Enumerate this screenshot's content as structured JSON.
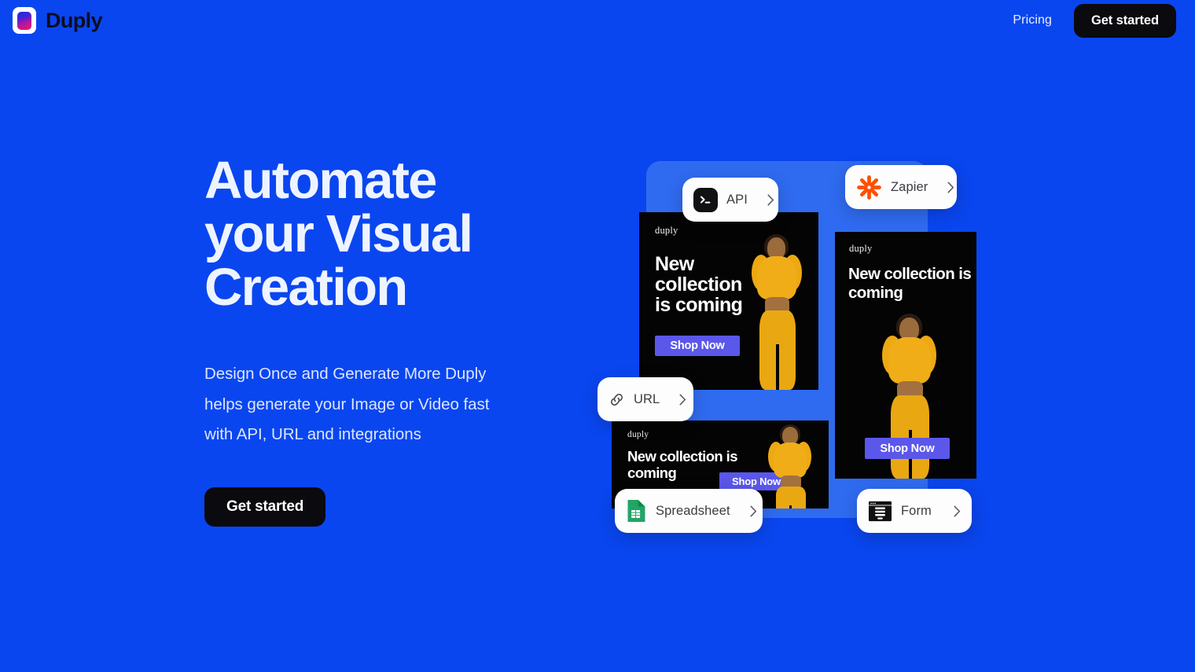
{
  "header": {
    "brand_name": "Duply",
    "brand_icon": "duply-logo-icon",
    "nav_links": [
      {
        "label": "Pricing",
        "name": "nav-link-pricing"
      }
    ],
    "cta_label": "Get started"
  },
  "hero": {
    "title_lines": [
      "Automate",
      "your Visual",
      "Creation"
    ],
    "title_full": "Automate your Visual Creation",
    "subtitle": "Design Once and Generate More Duply helps generate your Image or Video fast with API, URL and integrations",
    "cta_label": "Get started"
  },
  "integrations": [
    {
      "id": "api",
      "label": "API",
      "icon": "terminal-icon",
      "chevron": "chevron-right-icon"
    },
    {
      "id": "zapier",
      "label": "Zapier",
      "icon": "zapier-icon",
      "chevron": "chevron-right-icon"
    },
    {
      "id": "url",
      "label": "URL",
      "icon": "link-icon",
      "chevron": "chevron-right-icon"
    },
    {
      "id": "spreadsheet",
      "label": "Spreadsheet",
      "icon": "spreadsheet-icon",
      "chevron": "chevron-right-icon"
    },
    {
      "id": "form",
      "label": "Form",
      "icon": "form-icon",
      "chevron": "chevron-right-icon"
    }
  ],
  "creatives": [
    {
      "id": "creative-1",
      "brand": "duply",
      "headline": "New collection is coming",
      "button_label": "Shop Now",
      "format": "landscape"
    },
    {
      "id": "creative-2",
      "brand": "duply",
      "headline": "New collection is coming",
      "button_label": "Shop Now",
      "format": "portrait"
    },
    {
      "id": "creative-3",
      "brand": "duply",
      "headline": "New collection is coming",
      "button_label": "Shop Now",
      "format": "banner"
    }
  ],
  "colors": {
    "page_background": "#0a46ef",
    "panel_background": "#2f6bf0",
    "dark_button": "#0a0a0f",
    "creative_background": "#040404",
    "shop_now_purple": "#5b57ea",
    "zapier_orange": "#ff4f00",
    "sheets_green": "#23a566",
    "model_yellow": "#eda912",
    "heading_text": "#eef4ff"
  }
}
